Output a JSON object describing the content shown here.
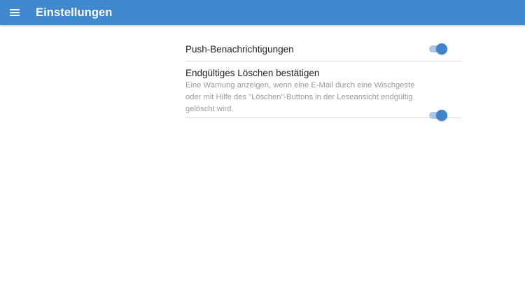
{
  "appbar": {
    "title": "Einstellungen",
    "background_color": "#4189cf",
    "menu_icon": "hamburger-menu-icon"
  },
  "settings": [
    {
      "title": "Push-Benachrichtigungen",
      "description": "",
      "enabled": true
    },
    {
      "title": "Endgültiges Löschen bestätigen",
      "description": "Eine Warnung anzeigen, wenn eine E-Mail durch eine Wischgeste oder mit Hilfe des \"Löschen\"-Buttons in der Leseansicht endgültig gelöscht wird.",
      "enabled": true
    }
  ],
  "colors": {
    "accent": "#3f83cc",
    "toggle_track": "#a9c8ea",
    "divider": "#dedede",
    "secondary_text": "#9a9a9a"
  }
}
